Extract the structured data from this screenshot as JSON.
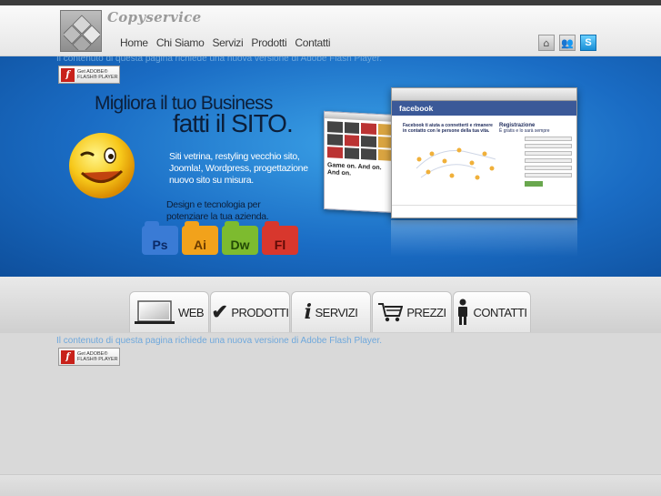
{
  "header": {
    "brand": "Copyservice",
    "nav": [
      "Home",
      "Chi Siamo",
      "Servizi",
      "Prodotti",
      "Contatti"
    ],
    "icons": [
      "home-icon",
      "users-icon",
      "skype-icon"
    ]
  },
  "flash": {
    "message": "Il contenuto di questa pagina richiede una nuova versione di Adobe Flash Player.",
    "badge_line1": "Get ADOBE®",
    "badge_line2": "FLASH® PLAYER"
  },
  "banner": {
    "headline1": "Migliora il tuo Business",
    "headline2": "fatti il SITO.",
    "description": "Siti vetrina, restyling vecchio sito, Joomla!, Wordpress, progettazione nuovo sito su misura.",
    "tagline": "Design e tecnologia per potenziare la tua azienda.",
    "folders": [
      {
        "label": "Ps",
        "color": "#3a7bd5",
        "text_color": "#0b2a66"
      },
      {
        "label": "Ai",
        "color": "#f2a21b",
        "text_color": "#6b3b00"
      },
      {
        "label": "Dw",
        "color": "#7dbb2f",
        "text_color": "#234a06"
      },
      {
        "label": "Fl",
        "color": "#d8372d",
        "text_color": "#5e0b06"
      }
    ],
    "screen_small_text": "Game on. And on. And on.",
    "facebook_brand": "facebook",
    "facebook_text": "Facebook ti aiuta a connetterti e rimanere in contatto con le persone della tua vita.",
    "facebook_reg_title": "Registrazione",
    "facebook_reg_sub": "È gratis e lo sarà sempre"
  },
  "tabs": [
    {
      "label": "WEB",
      "icon": "laptop-icon"
    },
    {
      "label": "PRODOTTI",
      "icon": "checkmark-icon"
    },
    {
      "label": "SERVIZI",
      "icon": "info-icon"
    },
    {
      "label": "PREZZI",
      "icon": "cart-icon"
    },
    {
      "label": "CONTATTI",
      "icon": "person-icon"
    }
  ],
  "colors": {
    "banner_blue": "#1a6cc4",
    "flash_text": "#6fa8dc",
    "facebook_blue": "#3b5998"
  }
}
